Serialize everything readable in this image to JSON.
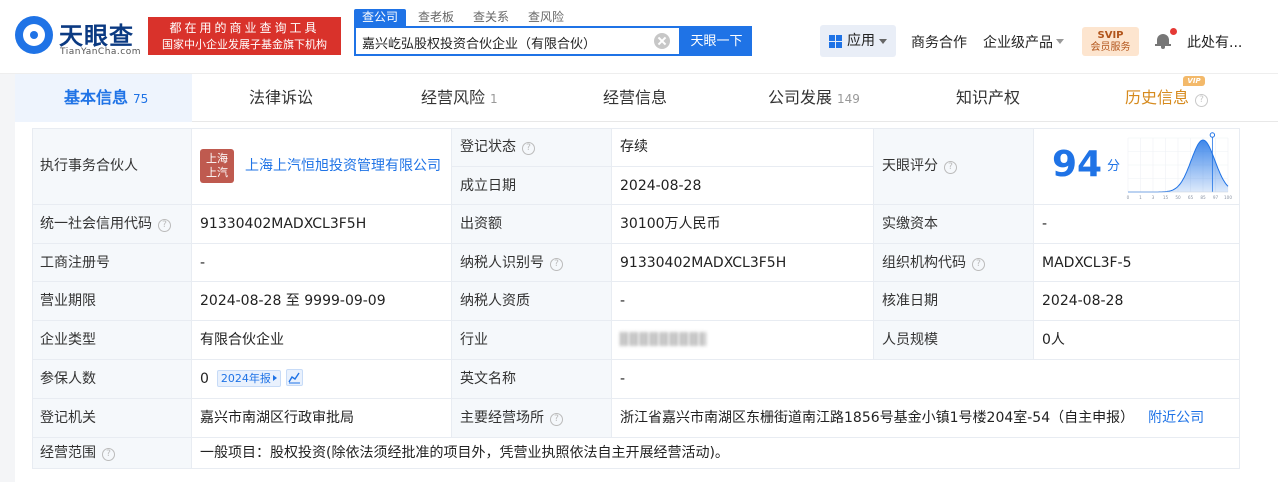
{
  "brand": {
    "name_cn": "天眼查",
    "name_en": "TianYanCha.com",
    "slogan_line1": "都在用的商业查询工具",
    "slogan_line2": "国家中小企业发展子基金旗下机构"
  },
  "search": {
    "tabs": [
      "查公司",
      "查老板",
      "查关系",
      "查风险"
    ],
    "value": "嘉兴屹弘股权投资合伙企业（有限合伙）",
    "button": "天眼一下"
  },
  "nav": {
    "apps": "应用",
    "business": "商务合作",
    "enterprise": "企业级产品",
    "svip_line1": "SVIP",
    "svip_line2": "会员服务",
    "user": "此处有..."
  },
  "tabs": [
    {
      "label": "基本信息",
      "count": "75"
    },
    {
      "label": "法律诉讼",
      "count": ""
    },
    {
      "label": "经营风险",
      "count": "1"
    },
    {
      "label": "经营信息",
      "count": ""
    },
    {
      "label": "公司发展",
      "count": "149"
    },
    {
      "label": "知识产权",
      "count": ""
    },
    {
      "label": "历史信息",
      "count": ""
    }
  ],
  "vip_badge": "VIP",
  "info": {
    "partner_label": "执行事务合伙人",
    "partner_logo_line1": "上海",
    "partner_logo_line2": "上汽",
    "partner_name": "上海上汽恒旭投资管理有限公司",
    "status_label": "登记状态",
    "status_value": "存续",
    "established_label": "成立日期",
    "established_value": "2024-08-28",
    "score_label": "天眼评分",
    "score_value": "94",
    "score_unit": "分",
    "credit_code_label": "统一社会信用代码",
    "credit_code_value": "91330402MADXCL3F5H",
    "capital_label": "出资额",
    "capital_value": "30100万人民币",
    "paid_label": "实缴资本",
    "paid_value": "-",
    "reg_no_label": "工商注册号",
    "reg_no_value": "-",
    "tax_id_label": "纳税人识别号",
    "tax_id_value": "91330402MADXCL3F5H",
    "org_code_label": "组织机构代码",
    "org_code_value": "MADXCL3F-5",
    "term_label": "营业期限",
    "term_value": "2024-08-28 至 9999-09-09",
    "tax_qual_label": "纳税人资质",
    "tax_qual_value": "-",
    "approve_label": "核准日期",
    "approve_value": "2024-08-28",
    "type_label": "企业类型",
    "type_value": "有限合伙企业",
    "industry_label": "行业",
    "staff_label": "人员规模",
    "staff_value": "0人",
    "insured_label": "参保人数",
    "insured_value": "0",
    "insured_badge": "2024年报",
    "english_label": "英文名称",
    "english_value": "-",
    "authority_label": "登记机关",
    "authority_value": "嘉兴市南湖区行政审批局",
    "address_label": "主要经营场所",
    "address_value": "浙江省嘉兴市南湖区东栅街道南江路1856号基金小镇1号楼204室-54（自主申报）",
    "nearby_link": "附近公司",
    "scope_label": "经营范围",
    "scope_value": "一般项目：股权投资(除依法须经批准的项目外，凭营业执照依法自主开展经营活动)。"
  },
  "chart_data": {
    "type": "area",
    "x": [
      0,
      1,
      3,
      15,
      50,
      65,
      85,
      97,
      100
    ],
    "tick_labels": [
      "0",
      "1",
      "3",
      "15",
      "50",
      "65",
      "85",
      "97",
      "100"
    ],
    "marker_value": 94,
    "xlim": [
      0,
      100
    ],
    "grid": true,
    "color": "#1f73e6"
  }
}
